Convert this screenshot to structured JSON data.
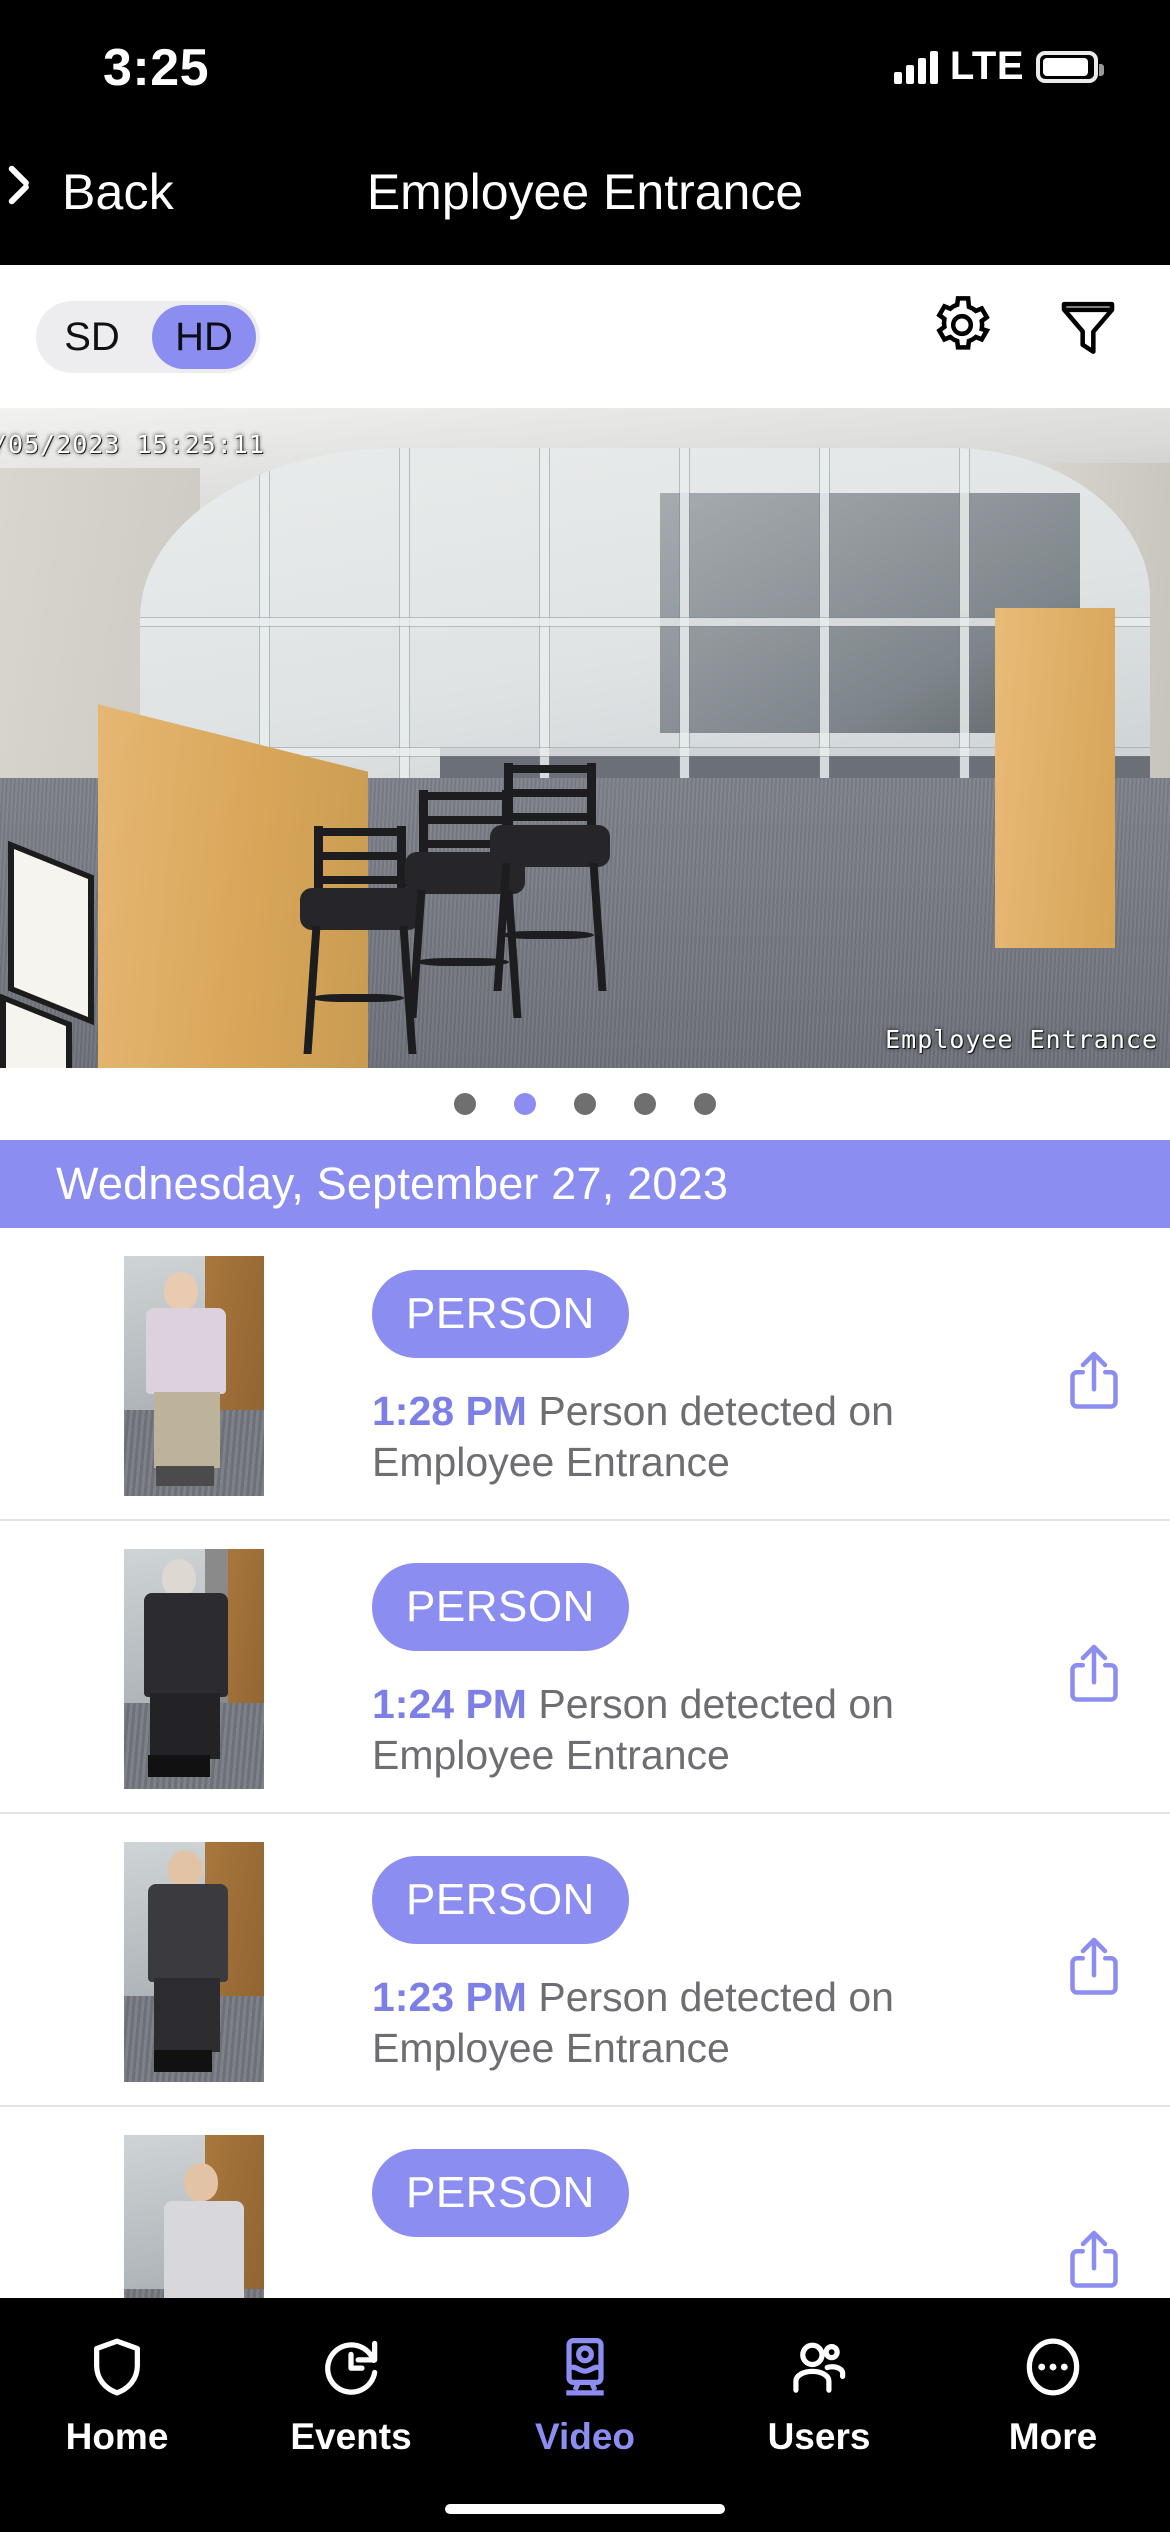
{
  "status_bar": {
    "time": "3:25",
    "network": "LTE",
    "signal_icon": "cellular-bars-icon",
    "battery_icon": "battery-icon"
  },
  "nav_bar": {
    "back_label": "Back",
    "back_icon": "chevron-left-icon",
    "title": "Employee Entrance"
  },
  "toolbar": {
    "quality_options": [
      "SD",
      "HD"
    ],
    "quality_selected": "HD",
    "settings_icon": "gear-icon",
    "filter_icon": "funnel-icon"
  },
  "video": {
    "timestamp_overlay": "/05/2023 15:25:11",
    "camera_label": "Employee Entrance",
    "page_dots": {
      "count": 5,
      "active_index": 1
    }
  },
  "date_header": {
    "label": "Wednesday, September 27, 2023"
  },
  "events": [
    {
      "badge": "PERSON",
      "time": "1:28 PM",
      "description": "Person detected on Employee Entrance",
      "share_icon": "share-icon",
      "thumbnail": "person-thumbnail"
    },
    {
      "badge": "PERSON",
      "time": "1:24 PM",
      "description": "Person detected on Employee Entrance",
      "share_icon": "share-icon",
      "thumbnail": "person-thumbnail"
    },
    {
      "badge": "PERSON",
      "time": "1:23 PM",
      "description": "Person detected on Employee Entrance",
      "share_icon": "share-icon",
      "thumbnail": "person-thumbnail"
    },
    {
      "badge": "PERSON",
      "time": "",
      "description": "",
      "share_icon": "share-icon",
      "thumbnail": "person-thumbnail"
    }
  ],
  "tab_bar": {
    "items": [
      {
        "label": "Home",
        "icon": "shield-icon",
        "active": false
      },
      {
        "label": "Events",
        "icon": "history-icon",
        "active": false
      },
      {
        "label": "Video",
        "icon": "monitor-camera-icon",
        "active": true
      },
      {
        "label": "Users",
        "icon": "users-icon",
        "active": false
      },
      {
        "label": "More",
        "icon": "more-circle-icon",
        "active": false
      }
    ]
  },
  "colors": {
    "accent": "#8b8ef0",
    "accent_text": "#7b7fe6",
    "background": "#ffffff",
    "chrome": "#000000",
    "muted_text": "#6d6d72"
  }
}
